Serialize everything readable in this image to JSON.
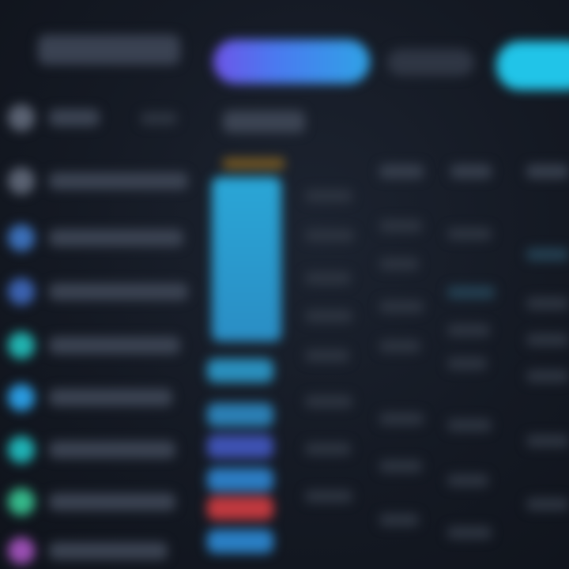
{
  "header": {
    "brand_label": "",
    "tabs": [
      {
        "label": "",
        "state": "active",
        "color": "#4a7af0"
      },
      {
        "label": "",
        "state": "idle",
        "color": "#2f3644"
      },
      {
        "label": "",
        "state": "accent",
        "color": "#21c4e8"
      }
    ]
  },
  "sidebar": {
    "items": [
      {
        "label": "",
        "icon": "grey-circle-icon",
        "color": "#5a6272"
      },
      {
        "label": "",
        "icon": "grey-circle-icon",
        "color": "#5a6272"
      },
      {
        "label": "",
        "icon": "blue-circle-icon",
        "color": "#3b6fb8"
      },
      {
        "label": "",
        "icon": "blue-circle-icon",
        "color": "#3b62b0"
      },
      {
        "label": "",
        "icon": "teal-circle-icon",
        "color": "#21b3b0"
      },
      {
        "label": "",
        "icon": "sky-circle-icon",
        "color": "#2a9be0"
      },
      {
        "label": "",
        "icon": "teal-circle-icon",
        "color": "#1fb2b5"
      },
      {
        "label": "",
        "icon": "green-circle-icon",
        "color": "#35b98a"
      },
      {
        "label": "",
        "icon": "purple-circle-icon",
        "color": "#9a4fb3"
      }
    ]
  },
  "main": {
    "title": "",
    "column_headers": [
      "",
      "",
      ""
    ],
    "chips": [
      {
        "color": "#2a8fbd"
      },
      {
        "color": "#2b7fb4"
      },
      {
        "color": "#3e52b2"
      },
      {
        "color": "#2c7cc2"
      },
      {
        "color": "#c0393f"
      },
      {
        "color": "#2a7fc4"
      }
    ]
  },
  "colors": {
    "background": "#141923",
    "accent_gradient_start": "#6d55e8",
    "accent_gradient_end": "#2fa3e6",
    "cyan_accent": "#21c4e8"
  }
}
